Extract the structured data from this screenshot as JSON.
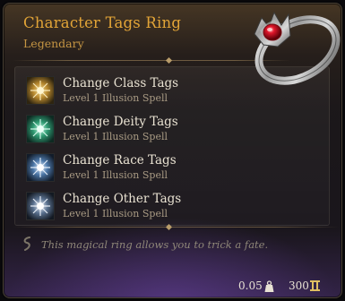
{
  "item": {
    "name": "Character Tags Ring",
    "rarity": "Legendary",
    "description": "This magical ring allows you to trick a fate.",
    "weight": "0.05",
    "value": "300"
  },
  "spells": [
    {
      "name": "Change Class Tags",
      "subtitle": "Level 1 Illusion Spell",
      "icon": "gold-sunburst-icon",
      "color": "#c9a23c"
    },
    {
      "name": "Change Deity Tags",
      "subtitle": "Level 1 Illusion Spell",
      "icon": "teal-sunburst-icon",
      "color": "#3fb08a"
    },
    {
      "name": "Change Race Tags",
      "subtitle": "Level 1 Illusion Spell",
      "icon": "blue-sunburst-icon",
      "color": "#7aa8d8"
    },
    {
      "name": "Change Other Tags",
      "subtitle": "Level 1 Illusion Spell",
      "icon": "silver-sunburst-icon",
      "color": "#8fb2d6"
    }
  ],
  "colors": {
    "title": "#e2a437",
    "rarity": "#c59543",
    "gem": "#e0152a"
  },
  "icons": {
    "item_art": "ring-with-red-gem-icon",
    "description": "swirl-icon",
    "weight": "weight-icon",
    "value": "gold-coin-icon"
  }
}
